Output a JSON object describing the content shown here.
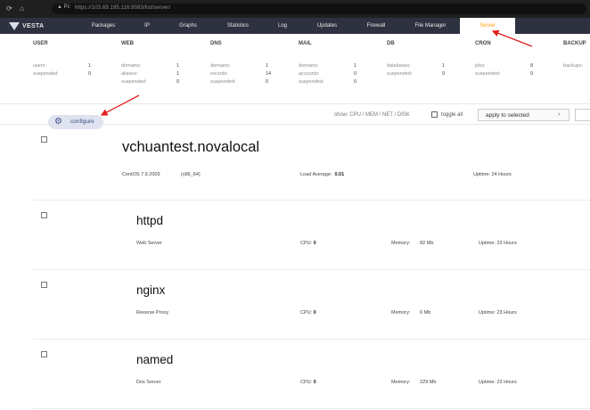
{
  "browser": {
    "url": "https://103.69.195.116:8083/list/server/"
  },
  "nav": {
    "logo": "VESTA",
    "items": [
      {
        "label": "Packages"
      },
      {
        "label": "IP"
      },
      {
        "label": "Graphs"
      },
      {
        "label": "Statistics"
      },
      {
        "label": "Log"
      },
      {
        "label": "Updates"
      },
      {
        "label": "Firewall"
      },
      {
        "label": "File Manager"
      },
      {
        "label": "Server"
      }
    ],
    "active": "Server"
  },
  "stats": {
    "user": {
      "title": "USER",
      "rows": [
        {
          "label": "users:",
          "value": "1"
        },
        {
          "label": "suspended:",
          "value": "0"
        }
      ]
    },
    "web": {
      "title": "WEB",
      "rows": [
        {
          "label": "domains:",
          "value": "1"
        },
        {
          "label": "aliases:",
          "value": "1"
        },
        {
          "label": "suspended:",
          "value": "0"
        }
      ]
    },
    "dns": {
      "title": "DNS",
      "rows": [
        {
          "label": "domains:",
          "value": "1"
        },
        {
          "label": "records:",
          "value": "14"
        },
        {
          "label": "suspended:",
          "value": "0"
        }
      ]
    },
    "mail": {
      "title": "MAIL",
      "rows": [
        {
          "label": "domains:",
          "value": "1"
        },
        {
          "label": "accounts:",
          "value": "0"
        },
        {
          "label": "suspended:",
          "value": "0"
        }
      ]
    },
    "db": {
      "title": "DB",
      "rows": [
        {
          "label": "databases:",
          "value": "1"
        },
        {
          "label": "suspended:",
          "value": "0"
        }
      ]
    },
    "cron": {
      "title": "CRON",
      "rows": [
        {
          "label": "jobs:",
          "value": "8"
        },
        {
          "label": "suspended:",
          "value": "0"
        }
      ]
    },
    "backup": {
      "title": "BACKUP",
      "rows": [
        {
          "label": "backups:",
          "value": ""
        }
      ]
    }
  },
  "toolbar": {
    "configure": "configure",
    "show": "show: CPU / MEM / NET / DISK",
    "toggle_all": "toggle all",
    "apply": "apply to selected"
  },
  "host": {
    "name": "vchuantest.novalocal",
    "os": "CentOS 7.9.2009",
    "arch": "(x86_64)",
    "load_label": "Load Average:",
    "load_value": "0.01",
    "uptime_label": "Uptime:",
    "uptime_value": "24 Hours"
  },
  "services": [
    {
      "name": "httpd",
      "desc": "Web Server",
      "cpu_label": "CPU:",
      "cpu": "0",
      "mem_label": "Memory:",
      "mem": "82 Mb",
      "uptime_label": "Uptime:",
      "uptime": "23 Hours"
    },
    {
      "name": "nginx",
      "desc": "Reverse Proxy",
      "cpu_label": "CPU:",
      "cpu": "0",
      "mem_label": "Memory:",
      "mem": "6 Mb",
      "uptime_label": "Uptime:",
      "uptime": "23 Hours"
    },
    {
      "name": "named",
      "desc": "Dns Server",
      "cpu_label": "CPU:",
      "cpu": "0",
      "mem_label": "Memory:",
      "mem": "229 Mb",
      "uptime_label": "Uptime:",
      "uptime": "23 Hours"
    }
  ],
  "colors": {
    "nav_bg": "#2d3140",
    "active": "#ff9a00",
    "annotation": "#e02020",
    "configure_bg": "#dfe3f0"
  }
}
